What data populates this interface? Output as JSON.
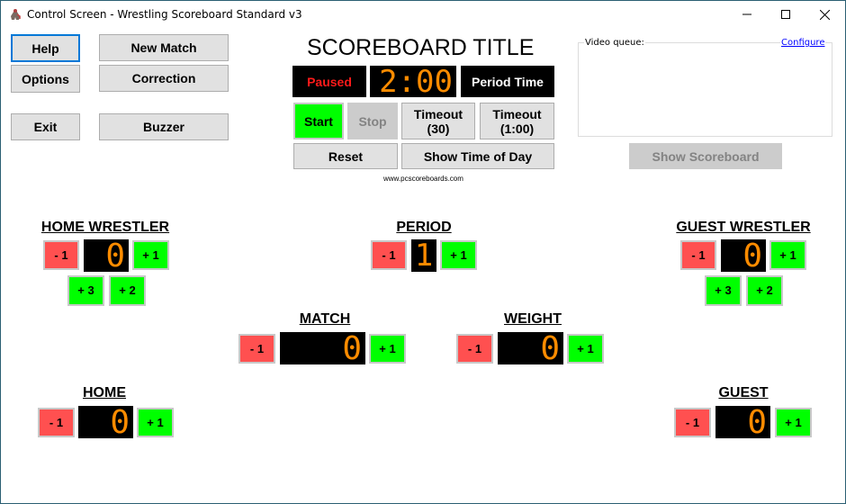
{
  "window": {
    "title": "Control Screen - Wrestling Scoreboard Standard v3",
    "controls": {
      "minimize": "—",
      "maximize": "☐",
      "close": "✕"
    }
  },
  "left_buttons": {
    "help": "Help",
    "options": "Options",
    "exit": "Exit",
    "new_match": "New Match",
    "correction": "Correction",
    "buzzer": "Buzzer"
  },
  "clock": {
    "title": "SCOREBOARD TITLE",
    "status": "Paused",
    "time": "2:00",
    "mode": "Period Time",
    "start": "Start",
    "stop": "Stop",
    "timeout30_line1": "Timeout",
    "timeout30_line2": "(30)",
    "timeout100_line1": "Timeout",
    "timeout100_line2": "(1:00)",
    "reset": "Reset",
    "show_time_of_day": "Show Time of Day",
    "website": "www.pcscoreboards.com"
  },
  "video_queue": {
    "label": "Video queue:",
    "configure": "Configure",
    "items": [],
    "show_scoreboard": "Show Scoreboard"
  },
  "home_wrestler": {
    "label": "HOME WRESTLER",
    "score": "0",
    "minus1": "- 1",
    "plus1": "+ 1",
    "plus3": "+ 3",
    "plus2": "+ 2"
  },
  "period": {
    "label": "PERIOD",
    "value": "1",
    "minus1": "- 1",
    "plus1": "+ 1"
  },
  "guest_wrestler": {
    "label": "GUEST WRESTLER",
    "score": "0",
    "minus1": "- 1",
    "plus1": "+ 1",
    "plus3": "+ 3",
    "plus2": "+ 2"
  },
  "match": {
    "label": "MATCH",
    "value": "0",
    "minus1": "- 1",
    "plus1": "+ 1"
  },
  "weight": {
    "label": "WEIGHT",
    "value": "0",
    "minus1": "- 1",
    "plus1": "+ 1"
  },
  "home": {
    "label": "HOME",
    "value": "0",
    "minus1": "- 1",
    "plus1": "+ 1"
  },
  "guest": {
    "label": "GUEST",
    "value": "0",
    "minus1": "- 1",
    "plus1": "+ 1"
  },
  "colors": {
    "plus": "#00ff00",
    "minus": "#ff5050",
    "digit": "#ff8c00",
    "paused": "#ff1a1a",
    "link": "#0000ff"
  }
}
